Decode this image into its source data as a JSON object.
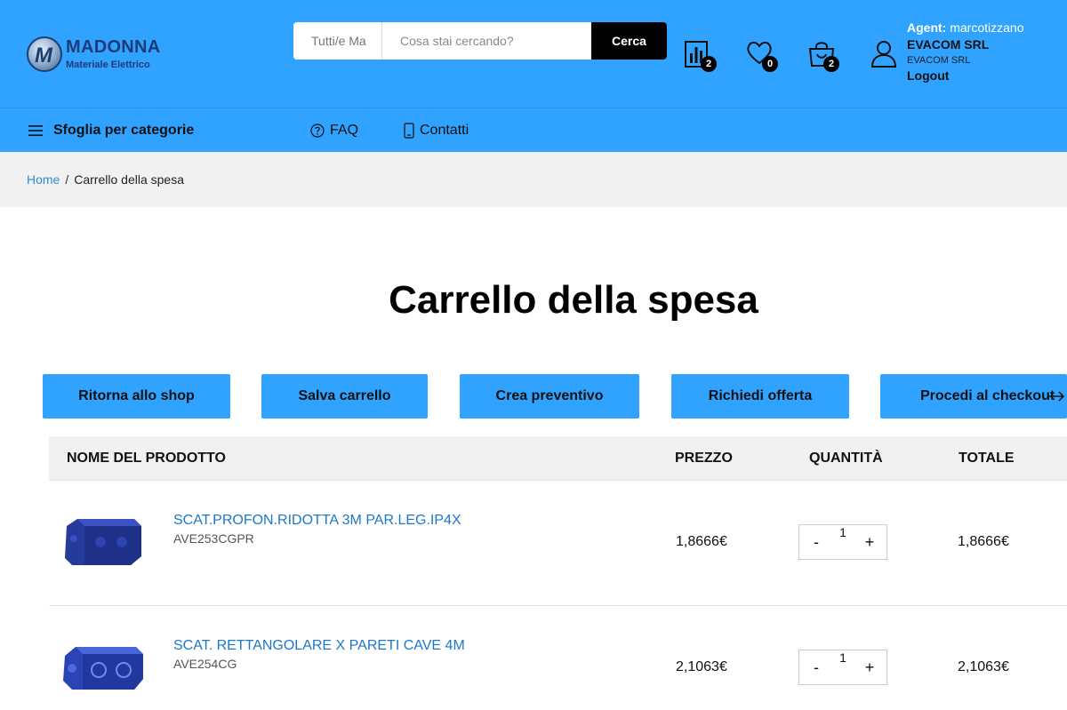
{
  "header": {
    "logo": {
      "name": "MADONNA",
      "subtitle": "Materiale Elettrico"
    },
    "search": {
      "category_placeholder": "Tutti/e Ma",
      "placeholder": "Cosa stai cercando?",
      "button": "Cerca"
    },
    "compare_count": "2",
    "wishlist_count": "0",
    "cart_count": "2",
    "agent": {
      "label": "Agent:",
      "name": "marcotizzano",
      "company": "EVACOM SRL",
      "company_small": "EVACOM SRL",
      "logout": "Logout"
    }
  },
  "nav": {
    "categories": "Sfoglia per categorie",
    "faq": "FAQ",
    "contacts": "Contatti"
  },
  "breadcrumb": {
    "home": "Home",
    "separator": "/",
    "current": "Carrello della spesa"
  },
  "page": {
    "title": "Carrello della spesa"
  },
  "actions": {
    "back": "Ritorna allo shop",
    "save": "Salva carrello",
    "quote": "Crea preventivo",
    "offer": "Richiedi offerta",
    "checkout": "Procedi al checkout"
  },
  "table": {
    "headers": {
      "product": "NOME DEL PRODOTTO",
      "price": "PREZZO",
      "quantity": "QUANTITÀ",
      "total": "TOTALE"
    },
    "rows": [
      {
        "name": "SCAT.PROFON.RIDOTTA 3M PAR.LEG.IP4X",
        "code": "AVE253CGPR",
        "price": "1,8666€",
        "quantity": "1",
        "total": "1,8666€"
      },
      {
        "name": "SCAT. RETTANGOLARE X PARETI CAVE 4M",
        "code": "AVE254CG",
        "price": "2,1063€",
        "quantity": "1",
        "total": "2,1063€"
      }
    ],
    "minus": "-",
    "plus": "+"
  },
  "colors": {
    "primary": "#2fa3ff",
    "link": "#1b78c8",
    "dark": "#000000"
  },
  "icons": [
    "hamburger-icon",
    "help-circle-icon",
    "phone-icon",
    "compare-chart-icon",
    "heart-icon",
    "shopping-bag-icon",
    "user-icon",
    "arrow-right-icon"
  ]
}
